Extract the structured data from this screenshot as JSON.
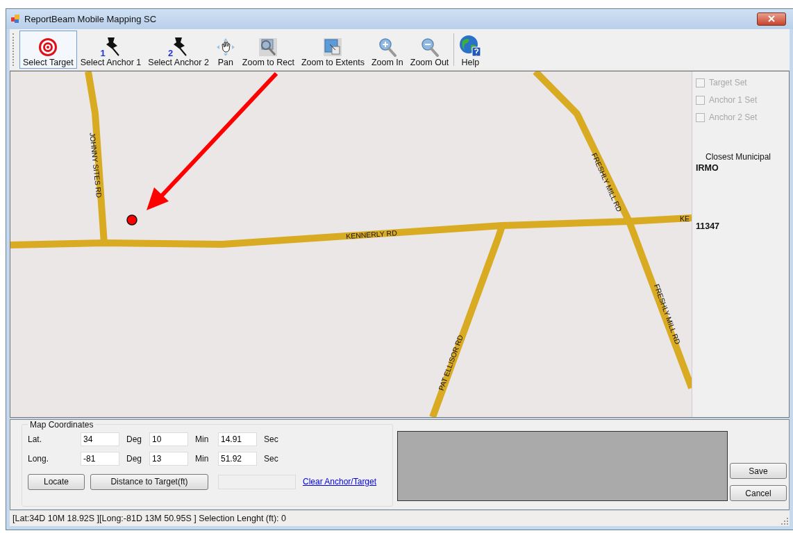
{
  "window": {
    "title": "ReportBeam Mobile Mapping SC"
  },
  "toolbar": [
    {
      "label": "Select Target",
      "selected": true
    },
    {
      "label": "Select Anchor 1",
      "badge": "1",
      "selected": false
    },
    {
      "label": "Select Anchor 2",
      "badge": "2",
      "selected": false
    },
    {
      "label": "Pan",
      "selected": false
    },
    {
      "label": "Zoom to Rect",
      "selected": false
    },
    {
      "label": "Zoom to Extents",
      "selected": false
    },
    {
      "label": "Zoom In",
      "selected": false
    },
    {
      "label": "Zoom Out",
      "selected": false
    },
    {
      "label": "Help",
      "selected": false
    }
  ],
  "map": {
    "road_labels": [
      "JOHNNY SITES RD",
      "KENNERLY RD",
      "FRESHLY MILL RD",
      "KE",
      "FRESHLY MILL RD",
      "PAT ELLISOR RD"
    ]
  },
  "side_panel": {
    "checkboxes": [
      {
        "label": "Target Set",
        "checked": false,
        "disabled": true
      },
      {
        "label": "Anchor 1 Set",
        "checked": false,
        "disabled": true
      },
      {
        "label": "Anchor 2 Set",
        "checked": false,
        "disabled": true
      }
    ],
    "municipal_label": "Closest Municipal",
    "municipal_value": "IRMO",
    "code": "11347"
  },
  "map_coordinates": {
    "title": "Map Coordinates",
    "rows": [
      {
        "label": "Lat.",
        "deg": "34",
        "deg_unit": "Deg",
        "min": "10",
        "min_unit": "Min",
        "sec": "14.91",
        "sec_unit": "Sec"
      },
      {
        "label": "Long.",
        "deg": "-81",
        "deg_unit": "Deg",
        "min": "13",
        "min_unit": "Min",
        "sec": "51.92",
        "sec_unit": "Sec"
      }
    ],
    "buttons": [
      "Locate",
      "Distance to Target(ft)"
    ],
    "link": "Clear Anchor/Target"
  },
  "buttons": [
    "Save",
    "Cancel"
  ],
  "status_bar": "[Lat:34D 10M 18.92S ][Long:-81D 13M 50.95S ]  Selection Lenght (ft): 0"
}
